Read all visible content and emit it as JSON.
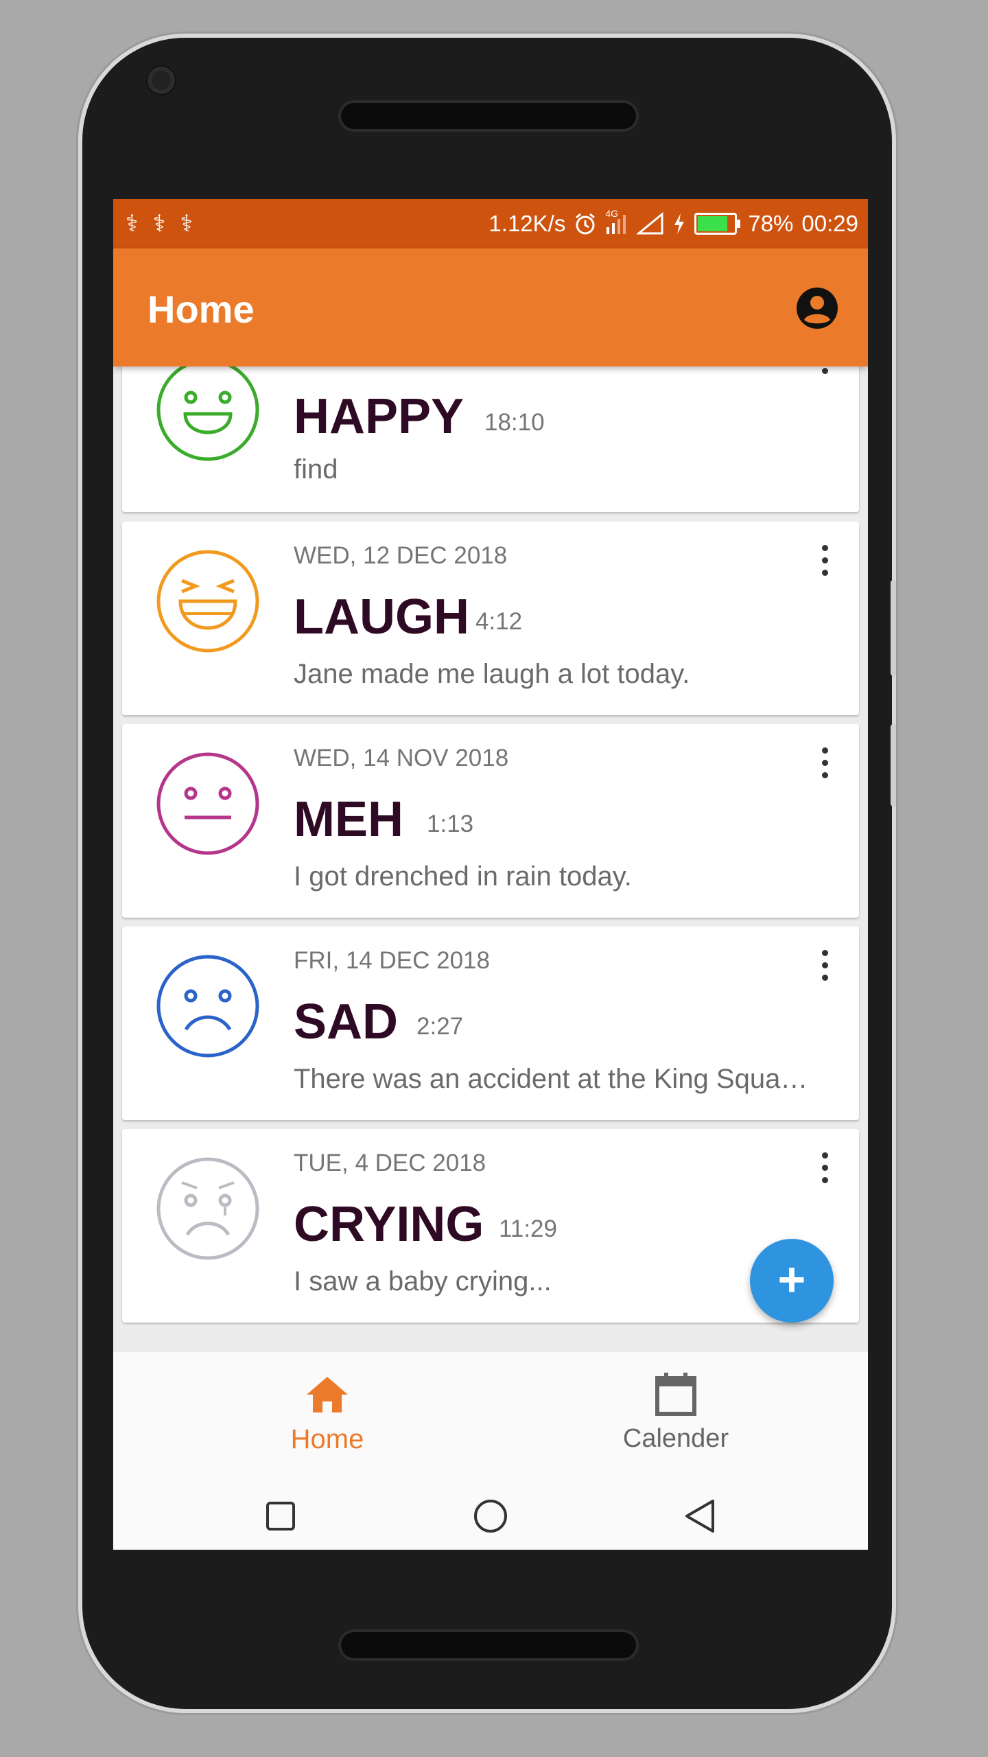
{
  "statusbar": {
    "left_icons": "⚕ ⚕ ⚕",
    "speed": "1.12K/s",
    "battery_level": 0.78,
    "battery_text": "78%",
    "clock": "00:29",
    "network_badge": "4G"
  },
  "appbar": {
    "title": "Home",
    "account_icon": "account-circle-icon"
  },
  "entries": [
    {
      "date": "",
      "mood": "HAPPY",
      "time": "18:10",
      "note": "find",
      "face": "happy-face-icon",
      "color": "#3aab2a"
    },
    {
      "date": "WED, 12 DEC 2018",
      "mood": "LAUGH",
      "time": "4:12",
      "note": "Jane made me laugh a lot today.",
      "face": "laugh-face-icon",
      "color": "#f29a1f"
    },
    {
      "date": "WED, 14 NOV 2018",
      "mood": "MEH",
      "time": "1:13",
      "note": "I got drenched in rain today.",
      "face": "meh-face-icon",
      "color": "#b5358a"
    },
    {
      "date": "FRI, 14 DEC 2018",
      "mood": "SAD",
      "time": "2:27",
      "note": "There was an accident at the King Squa…",
      "face": "sad-face-icon",
      "color": "#2a63c9"
    },
    {
      "date": "TUE, 4 DEC 2018",
      "mood": "CRYING",
      "time": "11:29",
      "note": "I saw a baby crying...",
      "face": "crying-face-icon",
      "color": "#b9bcc2"
    }
  ],
  "fab": {
    "label": "+"
  },
  "bottomnav": {
    "home_label": "Home",
    "calendar_label": "Calender",
    "active_color": "#eb7b2b",
    "inactive_color": "#666666"
  }
}
